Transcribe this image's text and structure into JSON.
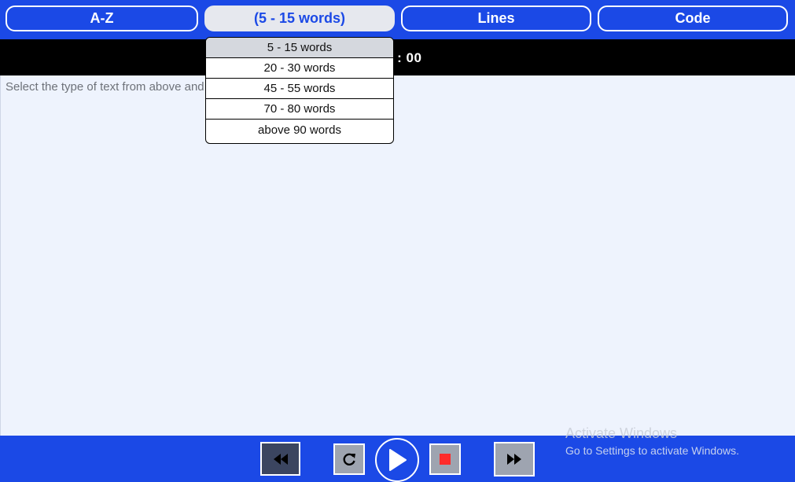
{
  "tabs": [
    {
      "label": "A-Z"
    },
    {
      "label": "(5 - 15 words)"
    },
    {
      "label": "Lines"
    },
    {
      "label": "Code"
    }
  ],
  "timer": {
    "value": "00 : 00"
  },
  "text_area": {
    "placeholder": "Select the type of text from above and start typing"
  },
  "dropdown": {
    "options": [
      {
        "label": "5 - 15 words",
        "selected": true
      },
      {
        "label": "20 - 30 words"
      },
      {
        "label": "45 - 55 words"
      },
      {
        "label": "70 - 80 words"
      },
      {
        "label": "above 90 words"
      }
    ]
  },
  "controls": {
    "rewind_icon": "rewind-icon",
    "reload_icon": "reload-icon",
    "play_icon": "play-icon",
    "stop_icon": "stop-icon",
    "forward_icon": "fast-forward-icon"
  },
  "watermark": {
    "title": "Activate Windows",
    "subtitle": "Go to Settings to activate Windows."
  },
  "colors": {
    "primary_blue": "#1b49e6",
    "active_tab_bg": "#e6e8ee",
    "text_area_bg": "#eef3fd",
    "stop_red": "#ff2b2b"
  }
}
